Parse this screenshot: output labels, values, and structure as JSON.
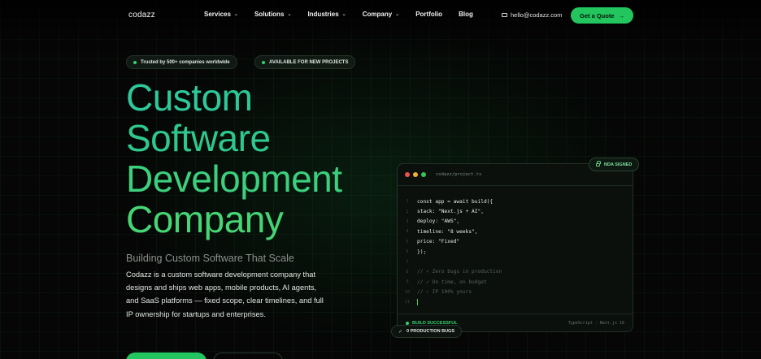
{
  "brand": "codazz",
  "nav": {
    "items": [
      {
        "label": "Services",
        "has_dropdown": true
      },
      {
        "label": "Solutions",
        "has_dropdown": true
      },
      {
        "label": "Industries",
        "has_dropdown": true
      },
      {
        "label": "Company",
        "has_dropdown": true
      },
      {
        "label": "Portfolio",
        "has_dropdown": false
      },
      {
        "label": "Blog",
        "has_dropdown": false
      }
    ],
    "dropdown_glyph": "⌄",
    "email": "hello@codazz.com",
    "cta_label": "Get a Quote",
    "cta_arrow": "→"
  },
  "badges": {
    "trusted": "Trusted by 500+ companies worldwide",
    "available": "AVAILABLE FOR NEW PROJECTS"
  },
  "hero": {
    "line1": "Custom",
    "line2": "Software",
    "line3": "Development",
    "line4": "Company",
    "subheading": "Building Custom Software That Scale",
    "description": "Codazz is a custom software development company that designs and ships web apps, mobile products, AI agents, and SaaS platforms — fixed scope, clear timelines, and full IP ownership for startups and enterprises."
  },
  "code_window": {
    "filename": "codazz/project.ts",
    "lines": [
      {
        "n": "1",
        "code": "const app = await build({",
        "comment": false
      },
      {
        "n": "2",
        "code": "   stack: \"Next.js + AI\",",
        "comment": false
      },
      {
        "n": "3",
        "code": "   deploy: \"AWS\",",
        "comment": false
      },
      {
        "n": "4",
        "code": "   timeline: \"8 weeks\",",
        "comment": false
      },
      {
        "n": "5",
        "code": "   price: \"Fixed\"",
        "comment": false
      },
      {
        "n": "6",
        "code": "});",
        "comment": false
      },
      {
        "n": "7",
        "code": "",
        "comment": false
      },
      {
        "n": "8",
        "code": "// ✓ Zero bugs in production",
        "comment": true
      },
      {
        "n": "9",
        "code": "// ✓ On time, on budget",
        "comment": true
      },
      {
        "n": "10",
        "code": "// ✓ IP 100% yours",
        "comment": true
      },
      {
        "n": "11",
        "code": "",
        "comment": false,
        "cursor": true
      }
    ],
    "build_status": "BUILD SUCCESSFUL",
    "stack_label": "TypeScript · Next.js 16"
  },
  "floating": {
    "nda": "NDA SIGNED",
    "bugs": "0 PRODUCTION BUGS",
    "bugs_glyph": "✓"
  },
  "colors": {
    "accent": "#22c55e",
    "background": "#050605",
    "dot_red": "#f0524f",
    "dot_yellow": "#f5b02e",
    "dot_green": "#33c55a"
  }
}
